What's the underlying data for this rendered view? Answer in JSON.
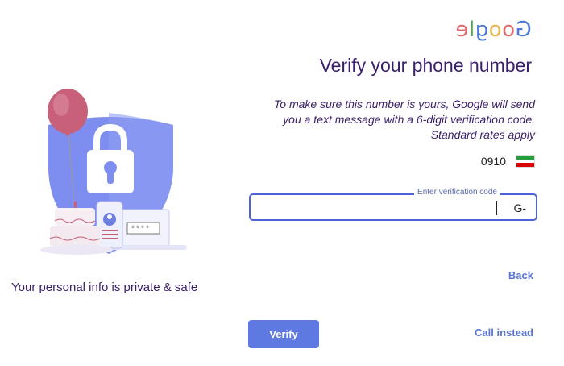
{
  "logo": {
    "letters": [
      {
        "char": "G",
        "color": "#4d7ad6"
      },
      {
        "char": "o",
        "color": "#e06a6a"
      },
      {
        "char": "o",
        "color": "#e8b64a"
      },
      {
        "char": "g",
        "color": "#4d7ad6"
      },
      {
        "char": "l",
        "color": "#53a653"
      },
      {
        "char": "e",
        "color": "#e06a6a"
      }
    ]
  },
  "page": {
    "title": "Verify your phone number",
    "description": "To make sure this number is yours, Google will send you a text message with a 6-digit verification code. Standard rates apply"
  },
  "phone": {
    "number": "0910",
    "flag_icon": "iran-flag-icon",
    "flag_colors": [
      "#239f40",
      "#ffffff",
      "#da0000"
    ]
  },
  "verification": {
    "label": "Enter verification code",
    "prefix": "G-"
  },
  "actions": {
    "back": "Back",
    "call_instead": "Call instead",
    "verify": "Verify"
  },
  "illustration": {
    "caption": "Your personal info is private & safe",
    "password_mask": "****"
  },
  "colors": {
    "accent": "#5f79e3",
    "title": "#3a1e6b",
    "shield": "#7e8ef0"
  }
}
